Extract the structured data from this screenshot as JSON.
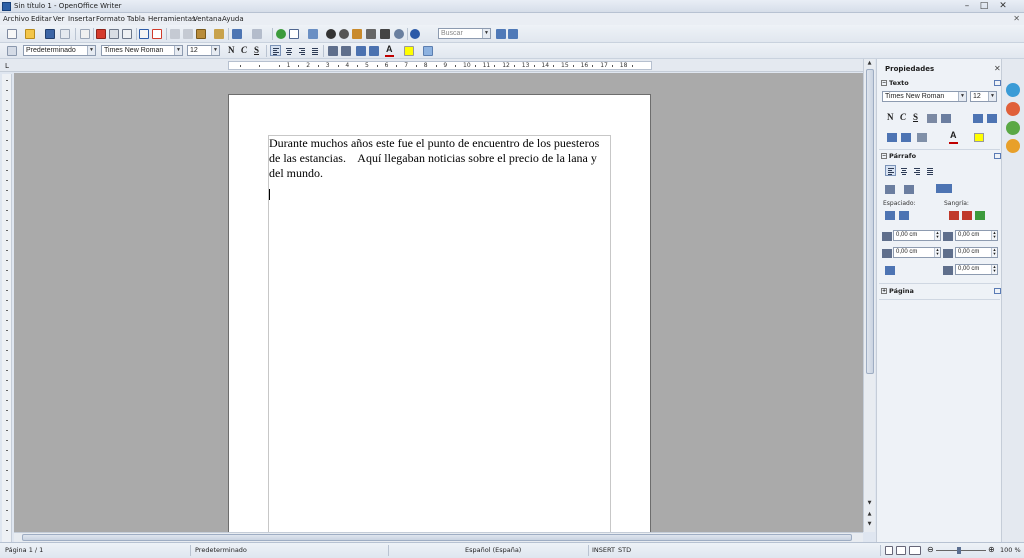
{
  "window": {
    "title": "Sin título 1 - OpenOffice Writer",
    "minimize": "–",
    "maximize": "□",
    "close": "✕"
  },
  "menu": {
    "items": [
      "Archivo",
      "Editar",
      "Ver",
      "Insertar",
      "Formato",
      "Tabla",
      "Herramientas",
      "Ventana",
      "Ayuda"
    ],
    "doc_close": "✕"
  },
  "toolbar": {
    "search_placeholder": "Buscar",
    "paragraph_style": "Predeterminado",
    "font_name": "Times New Roman",
    "font_size": "12",
    "bold_label": "N",
    "italic_label": "C",
    "underline_label": "S",
    "font_color_label": "A"
  },
  "ruler": {
    "numbers": [
      "1",
      "2",
      "3",
      "4",
      "5",
      "6",
      "7",
      "8",
      "9",
      "10",
      "11",
      "12",
      "13",
      "14",
      "15",
      "16",
      "17",
      "18"
    ],
    "corner": "L"
  },
  "document": {
    "text": "Durante muchos años este fue el punto de encuentro de los puesteros de las estancias.    Aquí llegaban noticias sobre el precio de la lana y del mundo."
  },
  "sidebar": {
    "title": "Propiedades",
    "close": "✕",
    "text_section": "Texto",
    "font_name": "Times New Roman",
    "font_size": "12",
    "bold_label": "N",
    "italic_label": "C",
    "underline_label": "S",
    "paragraph_section": "Párrafo",
    "spacing_label": "Espaciado:",
    "indent_label": "Sangría:",
    "spacing_above": "0,00 cm",
    "spacing_below": "0,00 cm",
    "indent_before": "0,00 cm",
    "indent_after": "0,00 cm",
    "indent_first": "0,00 cm",
    "page_section": "Página",
    "collapse_symbol": "−",
    "expand_symbol": "+"
  },
  "statusbar": {
    "page": "Página 1 / 1",
    "style": "Predeterminado",
    "language": "Español (España)",
    "insert_mode": "INSERT",
    "selection_mode": "STD",
    "zoom": "100 %"
  },
  "colors": {
    "font_color": "#c00000",
    "highlight": "#ffff00",
    "background_color": "#e8e8e8"
  }
}
